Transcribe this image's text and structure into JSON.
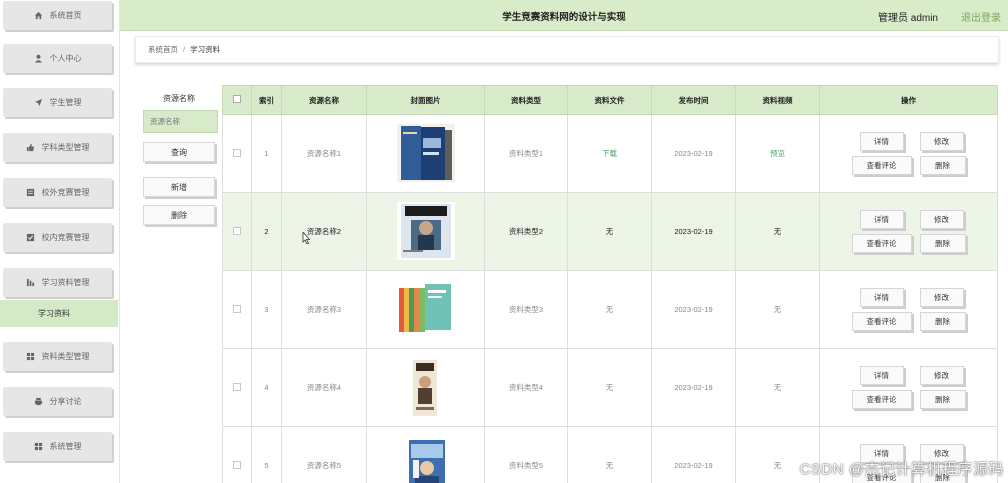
{
  "header": {
    "title": "学生竞赛资料网的设计与实现",
    "user": "管理员 admin",
    "logout": "退出登录"
  },
  "sidebar": {
    "items": [
      {
        "label": "系统首页",
        "icon": "home-icon"
      },
      {
        "label": "个人中心",
        "icon": "person-icon"
      },
      {
        "label": "学生管理",
        "icon": "send-icon"
      },
      {
        "label": "学科类型管理",
        "icon": "thumb-icon"
      },
      {
        "label": "校外竞赛管理",
        "icon": "list-icon"
      },
      {
        "label": "校内竞赛管理",
        "icon": "check-icon"
      },
      {
        "label": "学习资料管理",
        "icon": "chart-icon"
      },
      {
        "label": "资料类型管理",
        "icon": "grid-icon"
      },
      {
        "label": "分享讨论",
        "icon": "printer-icon"
      },
      {
        "label": "系统管理",
        "icon": "grid-icon"
      }
    ],
    "active_sub": "学习资料"
  },
  "breadcrumb": {
    "home": "系统首页",
    "separator": "/",
    "current": "学习资料"
  },
  "filter": {
    "label": "资源名称",
    "placeholder": "资源名称",
    "search": "查询",
    "add": "新增",
    "delete": "删除"
  },
  "table": {
    "headers": [
      "索引",
      "资源名称",
      "封面图片",
      "资料类型",
      "资料文件",
      "发布时间",
      "资料视频",
      "操作"
    ],
    "rows": [
      {
        "index": "1",
        "name": "资源名称1",
        "type": "资料类型1",
        "file": "下载",
        "date": "2023-02-19",
        "video": "预览",
        "cover": "cover-blue-book"
      },
      {
        "index": "2",
        "name": "资源名称2",
        "type": "资料类型2",
        "file": "无",
        "date": "2023-02-19",
        "video": "无",
        "cover": "cover-vogue-magazine"
      },
      {
        "index": "3",
        "name": "资源名称3",
        "type": "资料类型3",
        "file": "无",
        "date": "2023-02-19",
        "video": "无",
        "cover": "cover-book-set"
      },
      {
        "index": "4",
        "name": "资源名称4",
        "type": "资料类型4",
        "file": "无",
        "date": "2023-02-19",
        "video": "无",
        "cover": "cover-portrait-book"
      },
      {
        "index": "5",
        "name": "资源名称5",
        "type": "资料类型5",
        "file": "无",
        "date": "2023-02-19",
        "video": "无",
        "cover": "cover-anime-book"
      }
    ],
    "actions": {
      "detail": "详情",
      "edit": "修改",
      "comments": "查看评论",
      "delete": "删除"
    }
  },
  "watermark": "CSDN @杰记计算机程序源码",
  "colors": {
    "accent": "#d7eac9",
    "link": "#4ca36a",
    "logout": "#7da55e"
  }
}
